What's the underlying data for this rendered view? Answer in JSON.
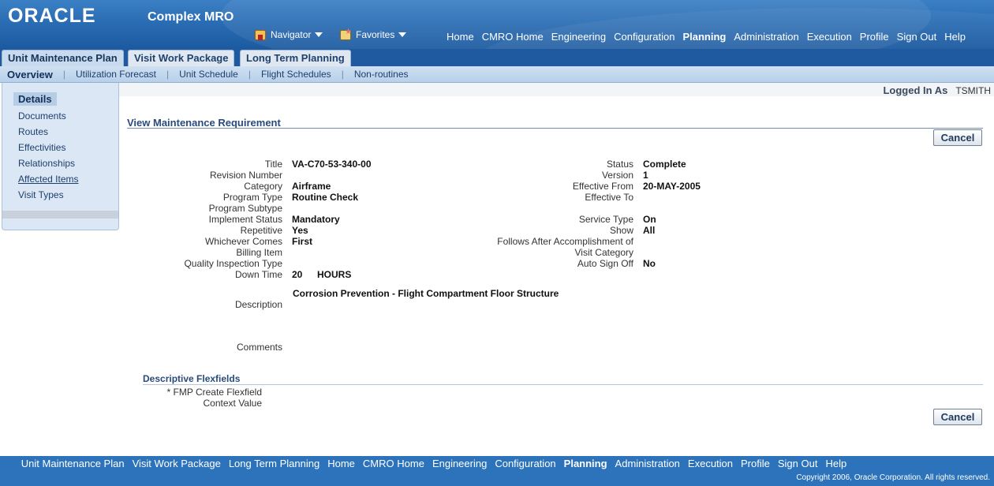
{
  "header": {
    "logo": "ORACLE",
    "app_name": "Complex MRO",
    "navigator": "Navigator",
    "favorites": "Favorites",
    "global_links": [
      "Home",
      "CMRO Home",
      "Engineering",
      "Configuration",
      "Planning",
      "Administration",
      "Execution",
      "Profile",
      "Sign Out",
      "Help"
    ],
    "active_global": "Planning"
  },
  "tabs": [
    "Unit Maintenance Plan",
    "Visit Work Package",
    "Long Term Planning"
  ],
  "subtabs": [
    "Overview",
    "Utilization Forecast",
    "Unit Schedule",
    "Flight Schedules",
    "Non-routines"
  ],
  "sidebar": {
    "items": [
      "Details",
      "Documents",
      "Routes",
      "Effectivities",
      "Relationships",
      "Affected Items",
      "Visit Types"
    ]
  },
  "user": {
    "label": "Logged In As",
    "name": "TSMITH"
  },
  "page": {
    "title": "View Maintenance Requirement",
    "cancel": "Cancel"
  },
  "left_fields": {
    "title_l": "Title",
    "title_v": "VA-C70-53-340-00",
    "revision_l": "Revision Number",
    "revision_v": "",
    "category_l": "Category",
    "category_v": "Airframe",
    "program_type_l": "Program Type",
    "program_type_v": "Routine Check",
    "program_subtype_l": "Program Subtype",
    "program_subtype_v": "",
    "implement_l": "Implement Status",
    "implement_v": "Mandatory",
    "repetitive_l": "Repetitive",
    "repetitive_v": "Yes",
    "whichever_l": "Whichever Comes",
    "whichever_v": "First",
    "billing_l": "Billing Item",
    "billing_v": "",
    "qit_l": "Quality Inspection Type",
    "qit_v": "",
    "down_l": "Down Time",
    "down_v": "20",
    "down_unit": "HOURS",
    "description_l": "Description",
    "description_v": "Corrosion Prevention - Flight Compartment Floor Structure",
    "comments_l": "Comments"
  },
  "right_fields": {
    "status_l": "Status",
    "status_v": "Complete",
    "version_l": "Version",
    "version_v": "1",
    "eff_from_l": "Effective From",
    "eff_from_v": "20-MAY-2005",
    "eff_to_l": "Effective To",
    "eff_to_v": "",
    "service_l": "Service Type",
    "service_v": "On",
    "show_l": "Show",
    "show_v": "All",
    "follows_l": "Follows After Accomplishment of",
    "follows_v": "",
    "visit_cat_l": "Visit Category",
    "visit_cat_v": "",
    "auto_l": "Auto Sign Off",
    "auto_v": "No"
  },
  "flex": {
    "title": "Descriptive Flexfields",
    "fmp_l": "* FMP Create Flexfield",
    "context_l": "Context Value"
  },
  "footer": {
    "links": [
      "Unit Maintenance Plan",
      "Visit Work Package",
      "Long Term Planning",
      "Home",
      "CMRO Home",
      "Engineering",
      "Configuration",
      "Planning",
      "Administration",
      "Execution",
      "Profile",
      "Sign Out",
      "Help"
    ],
    "active": "Planning",
    "copyright": "Copyright 2006, Oracle Corporation. All rights reserved."
  }
}
